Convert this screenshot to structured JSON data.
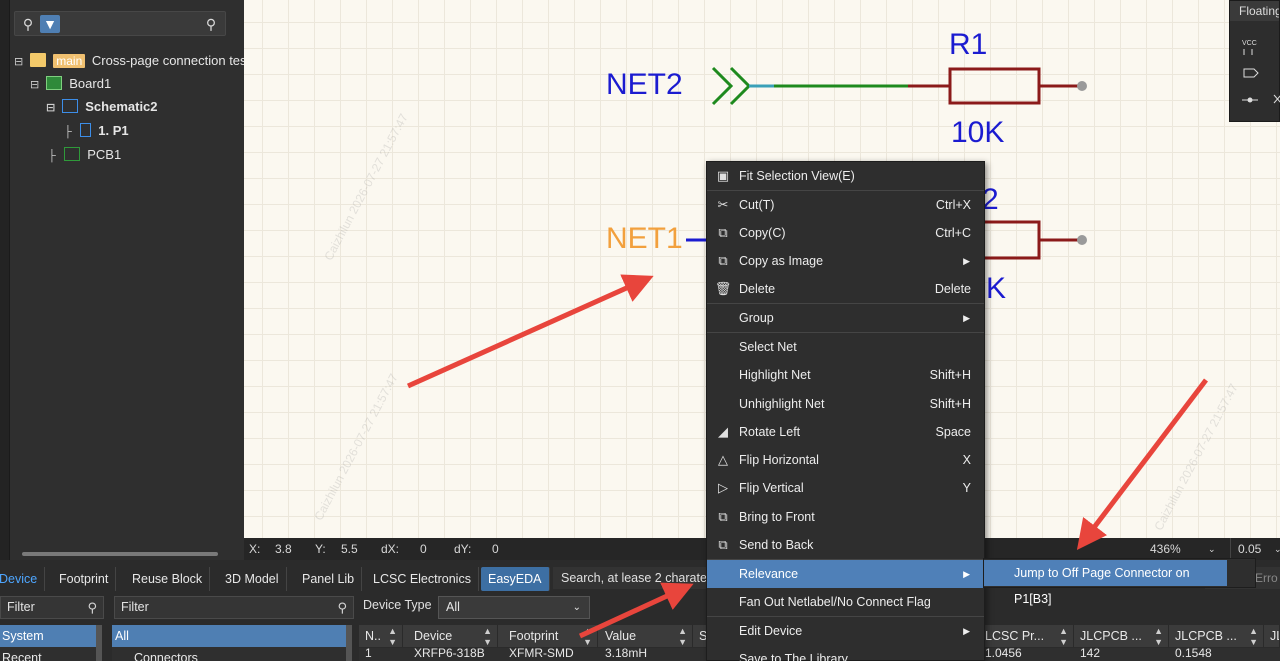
{
  "tree": {
    "tag": "main",
    "root_label": "Cross-page connection tes",
    "board": "Board1",
    "schematic": "Schematic2",
    "page": "1. P1",
    "pcb": "PCB1"
  },
  "canvas": {
    "r1_ref": "R1",
    "r1_val": "10K",
    "r2_ref_partial": "2",
    "r2_val_partial": "K",
    "net2": "NET2",
    "net1": "NET1",
    "watermark": "Caizhilun 2026-07-27 21:57:47"
  },
  "floating": {
    "title": "Floating",
    "vcc": "VCC"
  },
  "status": {
    "x_label": "X:",
    "x_val": "3.8",
    "y_label": "Y:",
    "y_val": "5.5",
    "dx_label": "dX:",
    "dx_val": "0",
    "dy_label": "dY:",
    "dy_val": "0",
    "zoom": "436%",
    "grid": "0.05"
  },
  "bottom_tabs": [
    "Device",
    "Footprint",
    "Reuse Block",
    "3D Model",
    "Panel Lib",
    "LCSC Electronics",
    "EasyEDA"
  ],
  "search_hint": "Search, at lease 2 charate",
  "filters": {
    "left_placeholder": "Filter",
    "mid_placeholder": "Filter",
    "device_type_label": "Device Type",
    "device_type_value": "All"
  },
  "sys_list": [
    "System",
    "Recent"
  ],
  "cat_list": [
    "All",
    "Connectors"
  ],
  "table": {
    "headers": [
      "N..",
      "Device",
      "Footprint",
      "Value",
      "S",
      "LCSC Pr...",
      "JLCPCB ...",
      "JLCPCB ...",
      "JL"
    ],
    "row": [
      "1",
      "XRFP6-318B",
      "XFMR-SMD",
      "3.18mH",
      "",
      "1.0456",
      "142",
      "0.1548",
      ""
    ]
  },
  "context_menu": [
    {
      "label": "Fit Selection View(E)",
      "shortcut": "",
      "icon": "fit-view-icon"
    },
    {
      "label": "Cut(T)",
      "shortcut": "Ctrl+X",
      "icon": "scissors-icon"
    },
    {
      "label": "Copy(C)",
      "shortcut": "Ctrl+C",
      "icon": "copy-icon"
    },
    {
      "label": "Copy as Image",
      "shortcut": "",
      "icon": "copy-image-icon",
      "submenu": true
    },
    {
      "label": "Delete",
      "shortcut": "Delete",
      "icon": "trash-icon"
    },
    {
      "label": "Group",
      "shortcut": "",
      "icon": "",
      "submenu": true
    },
    {
      "label": "Select Net",
      "shortcut": "",
      "icon": ""
    },
    {
      "label": "Highlight Net",
      "shortcut": "Shift+H",
      "icon": ""
    },
    {
      "label": "Unhighlight Net",
      "shortcut": "Shift+H",
      "icon": ""
    },
    {
      "label": "Rotate Left",
      "shortcut": "Space",
      "icon": "rotate-left-icon"
    },
    {
      "label": "Flip Horizontal",
      "shortcut": "X",
      "icon": "flip-horizontal-icon"
    },
    {
      "label": "Flip Vertical",
      "shortcut": "Y",
      "icon": "flip-vertical-icon"
    },
    {
      "label": "Bring to Front",
      "shortcut": "",
      "icon": "bring-front-icon"
    },
    {
      "label": "Send to Back",
      "shortcut": "",
      "icon": "send-back-icon"
    },
    {
      "label": "Relevance",
      "shortcut": "",
      "icon": "",
      "submenu": true,
      "highlighted": true
    },
    {
      "label": "Fan Out Netlabel/No Connect Flag",
      "shortcut": "",
      "icon": ""
    },
    {
      "label": "Edit Device",
      "shortcut": "",
      "icon": "",
      "submenu": true
    },
    {
      "label": "Save to The Library",
      "shortcut": "",
      "icon": ""
    }
  ],
  "submenu": {
    "label": "Jump to Off Page Connector on P1[B3]"
  },
  "right_errors_partial": "Erro",
  "colors": {
    "accent": "#4f80b8",
    "net_blue": "#1b1bd0",
    "net1_orange": "#f2a03d",
    "wire_green": "#1e8a1e",
    "resistor": "#8b1a1a",
    "arrow": "#e8453c"
  }
}
